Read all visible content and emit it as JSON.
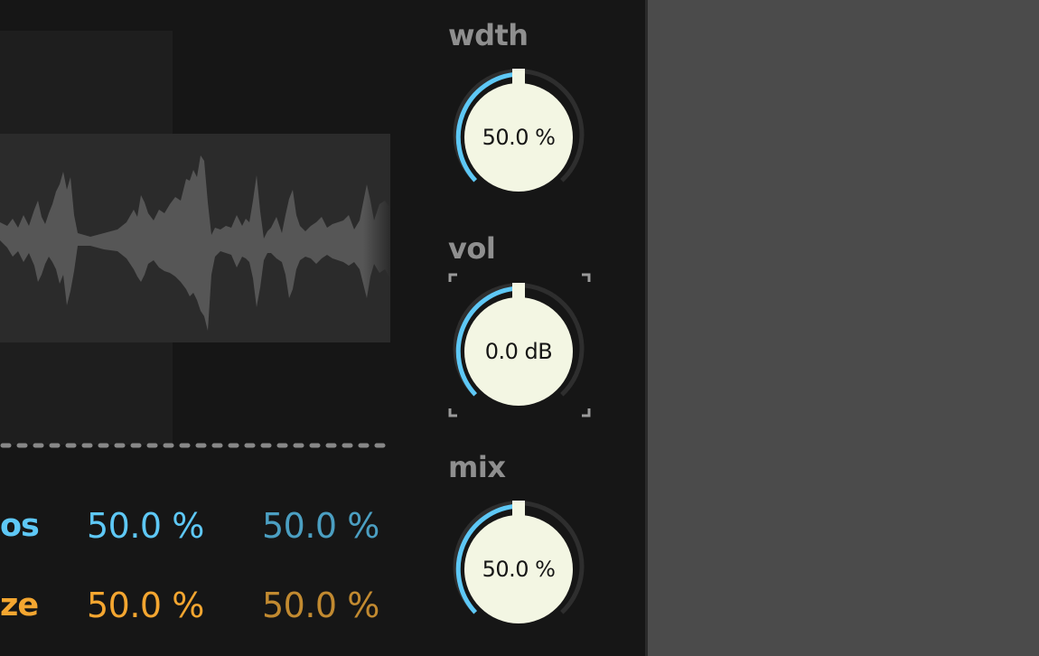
{
  "colors": {
    "accent_blue": "#5ec8f6",
    "accent_blue_dim": "#4b9fc2",
    "accent_orange": "#f4a630",
    "accent_orange_dim": "#c28a30",
    "knob_face": "#f3f6e3",
    "panel_bg": "#161616",
    "host_bg": "#4b4b4b"
  },
  "params": [
    {
      "label": "os",
      "value_a": "50.0 %",
      "value_b": "50.0 %",
      "color": "accent_blue"
    },
    {
      "label": "ze",
      "value_a": "50.0 %",
      "value_b": "50.0 %",
      "color": "accent_orange"
    }
  ],
  "knobs": [
    {
      "label": "wdth",
      "value": "50.0 %",
      "level": 0.5,
      "icon": "knob-dial"
    },
    {
      "label": "vol",
      "value": "0.0 dB",
      "level": 0.5,
      "icon": "knob-dial",
      "focused": true
    },
    {
      "label": "mix",
      "value": "50.0 %",
      "level": 0.5,
      "icon": "knob-dial"
    }
  ]
}
